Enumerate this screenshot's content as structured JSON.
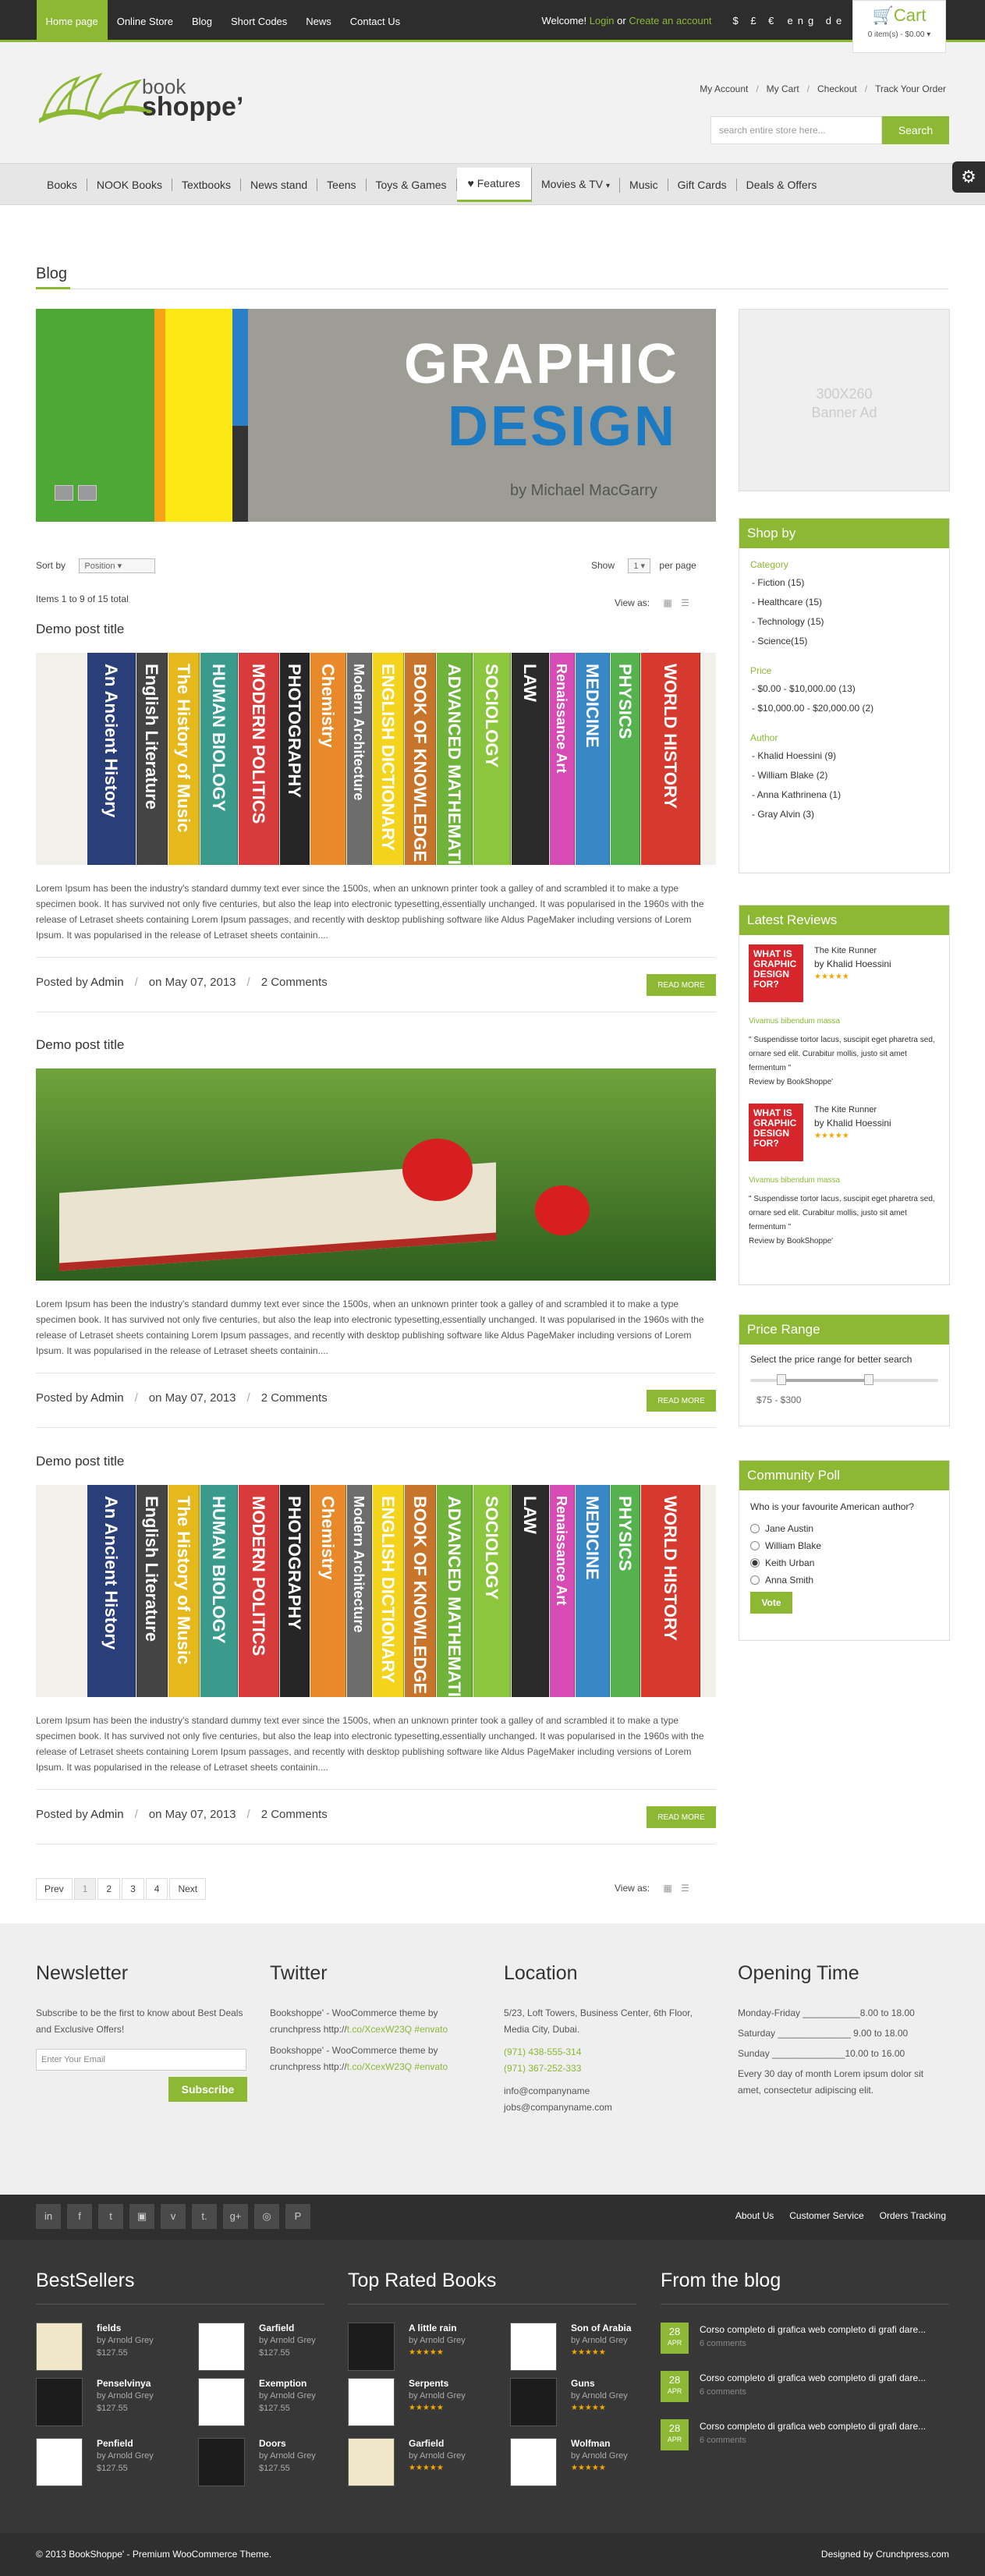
{
  "topbar": {
    "nav": [
      "Home page",
      "Online Store",
      "Blog",
      "Short Codes",
      "News",
      "Contact Us"
    ],
    "welcome_prefix": "Welcome!",
    "login": "Login",
    "or": "or",
    "create_account": "Create an account",
    "currencies": "$ £ €",
    "languages": "eng de fr",
    "cart_title": "Cart",
    "cart_items": "0 item(s) - $0.00"
  },
  "header": {
    "logo_top": "book",
    "logo_bottom": "shoppe’",
    "links": [
      "My Account",
      "My Cart",
      "Checkout",
      "Track Your Order"
    ],
    "search_placeholder": "search entire store here...",
    "search_button": "Search"
  },
  "nav": {
    "items": [
      "Books",
      "NOOK Books",
      "Textbooks",
      "News stand",
      "Teens",
      "Toys & Games",
      "Features",
      "Movies & TV",
      "Music",
      "Gift Cards",
      "Deals & Offers"
    ]
  },
  "page": {
    "title": "Blog",
    "banner_title1": "GRAPHIC",
    "banner_title2": "DESIGN",
    "banner_author": "by Michael MacGarry",
    "ad_text": "300X260",
    "ad_text2": "Banner Ad",
    "sort_label": "Sort by",
    "sort_value": "Position",
    "show_label": "Show",
    "show_value": "1",
    "per_page": "per page",
    "items_count": "Items 1 to 9 of 15 total",
    "view_as": "View as:"
  },
  "posts": [
    {
      "title": "Demo post title",
      "text": "Lorem Ipsum has been the industry's standard dummy text ever since the 1500s, when an unknown printer took a galley of and scrambled it to make a type specimen book. It has survived not only five centuries, but also the leap into electronic typesetting,essentially unchanged. It was popularised in the 1960s with the release of Letraset sheets containing Lorem Ipsum passages, and recently with desktop publishing software like Aldus PageMaker including versions of Lorem Ipsum. It was popularised in the release of Letraset sheets containin....",
      "posted_by": "Posted by",
      "author": "Admin",
      "date": "on May 07, 2013",
      "comments": "2 Comments",
      "read_more": "READ MORE"
    },
    {
      "title": "Demo post title",
      "text": "Lorem Ipsum has been the industry's standard dummy text ever since the 1500s, when an unknown printer took a galley of and scrambled it to make a type specimen book. It has survived not only five centuries, but also the leap into electronic typesetting,essentially unchanged. It was popularised in the 1960s with the release of Letraset sheets containing Lorem Ipsum passages, and recently with desktop publishing software like Aldus PageMaker including versions of Lorem Ipsum. It was popularised in the release of Letraset sheets containin....",
      "posted_by": "Posted by",
      "author": "Admin",
      "date": "on May 07, 2013",
      "comments": "2 Comments",
      "read_more": "READ MORE"
    },
    {
      "title": "Demo post title",
      "text": "Lorem Ipsum has been the industry's standard dummy text ever since the 1500s, when an unknown printer took a galley of and scrambled it to make a type specimen book. It has survived not only five centuries, but also the leap into electronic typesetting,essentially unchanged. It was popularised in the 1960s with the release of Letraset sheets containing Lorem Ipsum passages, and recently with desktop publishing software like Aldus PageMaker including versions of Lorem Ipsum. It was popularised in the release of Letraset sheets containin....",
      "posted_by": "Posted by",
      "author": "Admin",
      "date": "on May 07, 2013",
      "comments": "2 Comments",
      "read_more": "READ MORE"
    }
  ],
  "book_spines": [
    "An Ancient History",
    "English Literature",
    "The History of Music",
    "HUMAN BIOLOGY",
    "MODERN POLITICS",
    "PHOTOGRAPHY",
    "Chemistry",
    "Modern Architecture",
    "ENGLISH DICTIONARY",
    "BOOK OF KNOWLEDGE",
    "ADVANCED MATHEMATICS",
    "SOCIOLOGY",
    "LAW",
    "Renaissance Art",
    "MEDICINE",
    "PHYSICS",
    "WORLD HISTORY"
  ],
  "pagination": [
    "Prev",
    "1",
    "2",
    "3",
    "4",
    "Next"
  ],
  "sidebar": {
    "shop_by": "Shop by",
    "category_label": "Category",
    "categories": [
      "Fiction (15)",
      "Healthcare (15)",
      "Technology (15)",
      "Science(15)"
    ],
    "price_label": "Price",
    "prices": [
      "$0.00 - $10,000.00 (13)",
      "$10,000.00 - $20,000.00 (2)"
    ],
    "author_label": "Author",
    "authors": [
      "Khalid Hoessini (9)",
      "William Blake (2)",
      "Anna Kathrinena (1)",
      "Gray Alvin (3)"
    ],
    "latest_reviews": "Latest Reviews",
    "reviews": [
      {
        "thumb": "WHAT IS GRAPHIC DESIGN FOR?",
        "title": "The Kite Runner",
        "author": "by Khalid Hoessini",
        "stars": "★★★★★",
        "tagline": "Vivamus bibendum massa",
        "quote": "\" Suspendisse tortor lacus, suscipit eget pharetra sed, ornare sed elit. Curabitur mollis, justo sit amet fermentum \"",
        "by": "Review by BookShoppe'"
      },
      {
        "thumb": "WHAT IS GRAPHIC DESIGN FOR?",
        "title": "The Kite Runner",
        "author": "by Khalid Hoessini",
        "stars": "★★★★★",
        "tagline": "Vivamus bibendum massa",
        "quote": "\" Suspendisse tortor lacus, suscipit eget pharetra sed, ornare sed elit. Curabitur mollis, justo sit amet fermentum \"",
        "by": "Review by BookShoppe'"
      }
    ],
    "price_range": "Price Range",
    "price_range_desc": "Select the price range for better search",
    "price_range_value": "$75 - $300",
    "poll_title": "Community Poll",
    "poll_question": "Who is your favourite American author?",
    "poll_options": [
      "Jane Austin",
      "William Blake",
      "Keith Urban",
      "Anna Smith"
    ],
    "poll_selected": 2,
    "vote": "Vote"
  },
  "footer": {
    "newsletter_title": "Newsletter",
    "newsletter_text": "Subscribe to be the first to know about Best Deals and Exclusive Offers!",
    "email_placeholder": "Enter Your Email",
    "subscribe": "Subscribe",
    "twitter_title": "Twitter",
    "tweet_text": "Bookshoppe' - WooCommerce theme by crunchpress http://",
    "tweet_link": "t.co/XcexW23Q #envato",
    "location_title": "Location",
    "address": "5/23, Loft Towers, Business Center, 6th Floor, Media City, Dubai.",
    "phone1": "(971) 438-555-314",
    "phone2": "(971) 367-252-333",
    "email1": "info@companyname",
    "email2": "jobs@companyname.com",
    "hours_title": "Opening Time",
    "hours": [
      "Monday-Friday ___________8.00 to 18.00",
      "Saturday ______________ 9.00 to 18.00",
      "Sunday ______________10.00 to 16.00"
    ],
    "hours_note": "Every 30 day of month Lorem ipsum dolor sit amet, consectetur adipiscing elit.",
    "social_icons": [
      "in",
      "f",
      "t",
      "▣",
      "v",
      "t.",
      "g+",
      "◎",
      "P"
    ],
    "links": [
      "About Us",
      "Customer Service",
      "Orders Tracking"
    ],
    "bestsellers_title": "BestSellers",
    "bestsellers": [
      {
        "name": "fields",
        "author": "by Arnold Grey",
        "price": "$127.55"
      },
      {
        "name": "Garfield",
        "author": "by Arnold Grey",
        "price": "$127.55"
      },
      {
        "name": "Penselvinya",
        "author": "by Arnold Grey",
        "price": "$127.55"
      },
      {
        "name": "Exemption",
        "author": "by Arnold Grey",
        "price": "$127.55"
      },
      {
        "name": "Penfield",
        "author": "by Arnold Grey",
        "price": "$127.55"
      },
      {
        "name": "Doors",
        "author": "by Arnold Grey",
        "price": "$127.55"
      }
    ],
    "toprated_title": "Top Rated Books",
    "toprated": [
      {
        "name": "A little rain",
        "author": "by Arnold Grey",
        "stars": "★★★★★"
      },
      {
        "name": "Son of Arabia",
        "author": "by Arnold Grey",
        "stars": "★★★★★"
      },
      {
        "name": "Serpents",
        "author": "by Arnold Grey",
        "stars": "★★★★★"
      },
      {
        "name": "Guns",
        "author": "by Arnold Grey",
        "stars": "★★★★★"
      },
      {
        "name": "Garfield",
        "author": "by Arnold Grey",
        "stars": "★★★★★"
      },
      {
        "name": "Wolfman",
        "author": "by Arnold Grey",
        "stars": "★★★★★"
      }
    ],
    "blog_title": "From the blog",
    "blog_posts": [
      {
        "day": "28",
        "month": "APR",
        "title": "Corso completo di grafica web completo di grafi dare...",
        "comments": "6 comments"
      },
      {
        "day": "28",
        "month": "APR",
        "title": "Corso completo di grafica web completo di grafi dare...",
        "comments": "6 comments"
      },
      {
        "day": "28",
        "month": "APR",
        "title": "Corso completo di grafica web completo di grafi dare...",
        "comments": "6 comments"
      }
    ],
    "copyright": "© 2013 BookShoppe' - Premium WooCommerce Theme.",
    "designed_by": "Designed by Crunchpress.com"
  },
  "colors": {
    "accent": "#8cb834",
    "dark": "#2d2d2d"
  }
}
